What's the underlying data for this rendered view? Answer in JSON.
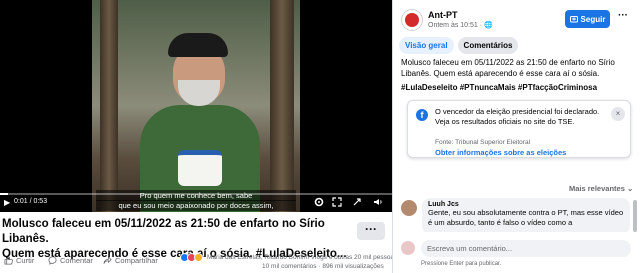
{
  "video": {
    "subtitle_line1": "Pro quem me conhece bem, sabe",
    "subtitle_line2": "que eu sou meio apaixonado por doces assim,",
    "time": "0:01 / 0:53",
    "progress": 0.02
  },
  "post": {
    "title_line1": "Molusco faleceu em 05/11/2022 as 21:50 de enfarto no Sírio Libanês.",
    "title_line2": "Quem está aparecendo é esse cara aí o sósia. #LulaDeseleito...",
    "more_label": "···"
  },
  "actions": {
    "like": "Curtir",
    "comment": "Comentar",
    "share": "Compartilhar",
    "reaction_names": "Maria das Estrelas, Ricardo Bonfim Vlogs e outras 20 mil pessoas",
    "stats": "10 mil comentários · 896 mil visualizações",
    "react_colors": [
      "#1877f2",
      "#f33e58",
      "#f7b125"
    ]
  },
  "panel": {
    "page_name": "Ant-PT",
    "meta": "Ontem às 10:51 · ",
    "follow_label": "Seguir",
    "more_dots": "···",
    "tabs": [
      {
        "label": "Visão geral"
      },
      {
        "label": "Comentários"
      }
    ],
    "caption": "Molusco faleceu em 05/11/2022 as 21:50 de enfarto no Sírio Libanês. Quem está aparecendo é esse cara aí o sósia.",
    "hashtags": "#LulaDeseleito #PTnuncaMais #PTfacçãoCriminosa"
  },
  "election_notice": {
    "text": "O vencedor da eleição presidencial foi declarado. Veja os resultados oficiais no site do TSE.",
    "source": "Fonte: Tribunal Superior Eleitoral",
    "link": "Obter informações sobre as eleições",
    "close": "×"
  },
  "comments": {
    "sort_label": "Mais relevantes ⌄",
    "items": [
      {
        "name": "Luuh Jcs",
        "text": "Gente, eu sou absolutamente contra o PT, mas esse vídeo é um absurdo, tanto é falso o vídeo como a"
      }
    ],
    "input_placeholder": "Escreva um comentário...",
    "hint": "Pressione Enter para publicar."
  },
  "colors": {
    "accent": "#1b74e4",
    "muted": "#65676b"
  }
}
